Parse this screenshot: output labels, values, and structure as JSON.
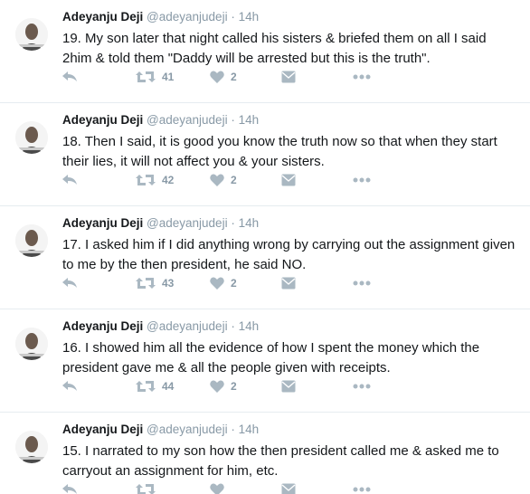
{
  "tweets": [
    {
      "name": "Adeyanju Deji",
      "handle": "@adeyanjudeji",
      "sep": "·",
      "time": "14h",
      "text": "19. My son later that night called his sisters & briefed them on all I said 2him & told them \"Daddy will be arrested but this is the truth\".",
      "retweets": "41",
      "likes": "2"
    },
    {
      "name": "Adeyanju Deji",
      "handle": "@adeyanjudeji",
      "sep": "·",
      "time": "14h",
      "text": "18. Then I said, it is good you know the truth now so that when they start their lies, it will not affect you & your sisters.",
      "retweets": "42",
      "likes": "2"
    },
    {
      "name": "Adeyanju Deji",
      "handle": "@adeyanjudeji",
      "sep": "·",
      "time": "14h",
      "text": "17. I asked him if I did anything wrong by carrying out the assignment given to me by the then president, he said NO.",
      "retweets": "43",
      "likes": "2"
    },
    {
      "name": "Adeyanju Deji",
      "handle": "@adeyanjudeji",
      "sep": "·",
      "time": "14h",
      "text": "16. I showed him all the evidence of how I spent the money which the president gave me & all the people given with receipts.",
      "retweets": "44",
      "likes": "2"
    },
    {
      "name": "Adeyanju Deji",
      "handle": "@adeyanjudeji",
      "sep": "·",
      "time": "14h",
      "text": "15. I narrated to my son how the then president called me & asked me to carryout an assignment for him, etc.",
      "retweets": "",
      "likes": ""
    }
  ],
  "icons": {
    "reply": "reply-icon",
    "retweet": "retweet-icon",
    "like": "heart-icon",
    "message": "direct-message-icon",
    "more": "more-dots-icon"
  },
  "colors": {
    "icon": "#aab8c2",
    "meta": "#8899a6",
    "text": "#14171a",
    "divider": "#e6ecf0"
  }
}
